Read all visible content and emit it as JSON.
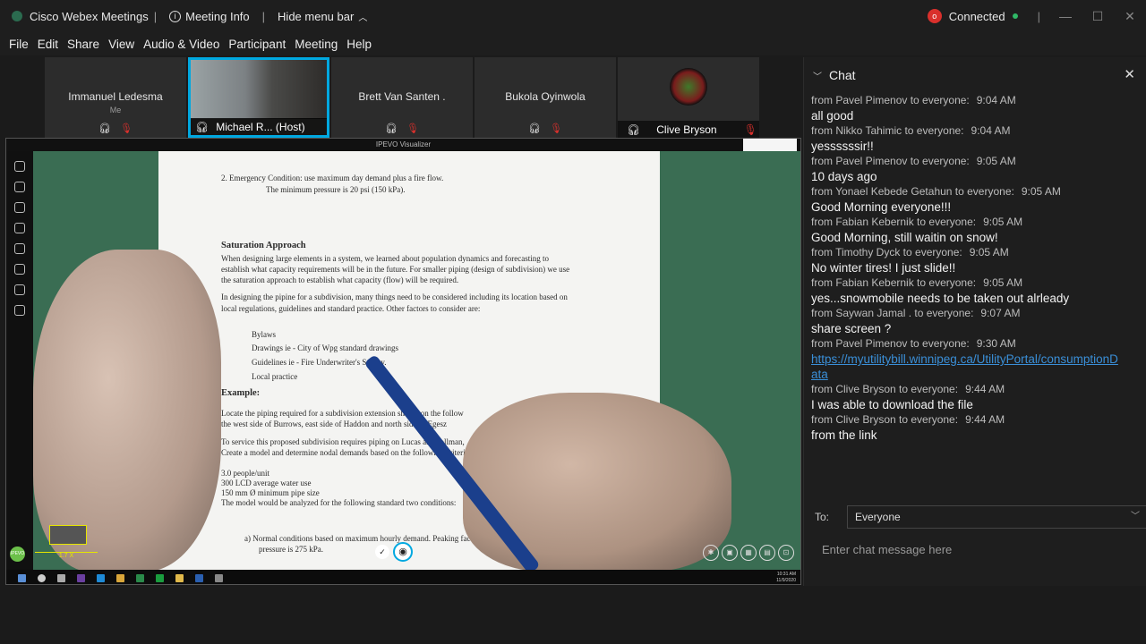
{
  "titlebar": {
    "app_name": "Cisco Webex Meetings",
    "meeting_info": "Meeting Info",
    "hide_menu": "Hide menu bar",
    "connection_status": "Connected"
  },
  "menu": [
    "File",
    "Edit",
    "Share",
    "View",
    "Audio & Video",
    "Participant",
    "Meeting",
    "Help"
  ],
  "participants": [
    {
      "name": "Immanuel Ledesma",
      "sub": "Me"
    },
    {
      "name": "Michael R... (Host)"
    },
    {
      "name": "Brett Van Santen ."
    },
    {
      "name": "Bukola Oyinwola"
    },
    {
      "name": "Clive Bryson"
    }
  ],
  "share": {
    "window_title": "IPEVO Visualizer",
    "zoom_label": "1.7 X",
    "logo_text": "IPEVO",
    "clock_time": "10:31 AM",
    "clock_date": "11/9/2020",
    "paper_lines": [
      "2.  Emergency Condition: use maximum day demand plus a fire flow.",
      "The minimum pressure is 20 psi (150 kPa).",
      "Saturation Approach",
      "When designing large elements in a system, we learned about population dynamics and forecasting to",
      "establish what capacity requirements will be in the future.  For smaller piping (design of subdivision) we use",
      "the saturation approach to establish what capacity (flow) will be required.",
      "In designing the pipine for a subdivision, many things need to be considered including its location based on",
      "local regulations, guidelines and standard practice.  Other factors to consider are:",
      "Bylaws",
      "Drawings       ie - City of Wpg standard drawings",
      "Guidelines        ie - Fire Underwriter's Survey.",
      "Local practice",
      "Example:",
      "Locate the piping required for a subdivision extension shown on the follow",
      "the west side of Burrows, east side of Haddon and north side of Egesz",
      "To service this proposed subdivision requires piping on Lucas and Tallman,",
      "Create a model and determine nodal demands based on the following criteri",
      "3.0  people/unit",
      "300  LCD average water use",
      "150 mm Ø minimum pipe size",
      "The model would be analyzed for the following standard two conditions:",
      "a)  Normal conditions based on maximum hourly demand.  Peaking fact",
      "pressure is 275 kPa."
    ]
  },
  "chat": {
    "title": "Chat",
    "messages": [
      {
        "from": "from Pavel Pimenov to everyone:",
        "time": "9:04 AM",
        "text": "all good"
      },
      {
        "from": "from Nikko Tahimic to everyone:",
        "time": "9:04 AM",
        "text": "yessssssir!!"
      },
      {
        "from": "from Pavel Pimenov to everyone:",
        "time": "9:05 AM",
        "text": "10 days ago"
      },
      {
        "from": "from Yonael Kebede Getahun to everyone:",
        "time": "9:05 AM",
        "text": "Good Morning everyone!!!"
      },
      {
        "from": "from Fabian Kebernik to everyone:",
        "time": "9:05 AM",
        "text": "Good Morning, still waitin on snow!"
      },
      {
        "from": "from Timothy Dyck to everyone:",
        "time": "9:05 AM",
        "text": "No winter tires!  I just slide!!"
      },
      {
        "from": "from Fabian Kebernik to everyone:",
        "time": "9:05 AM",
        "text": "yes...snowmobile needs to be taken out alrleady"
      },
      {
        "from": "from Saywan Jamal . to everyone:",
        "time": "9:07 AM",
        "text": "share screen ?"
      },
      {
        "from": "from Pavel Pimenov to everyone:",
        "time": "9:30 AM",
        "text": "https://myutilitybill.winnipeg.ca/UtilityPortal/consumptionData",
        "link": true
      },
      {
        "from": "from Clive Bryson to everyone:",
        "time": "9:44 AM",
        "text": "I was able to download the file"
      },
      {
        "from": "from Clive Bryson to everyone:",
        "time": "9:44 AM",
        "text": "from the link"
      }
    ],
    "to_label": "To:",
    "to_value": "Everyone",
    "input_placeholder": "Enter chat message here"
  }
}
